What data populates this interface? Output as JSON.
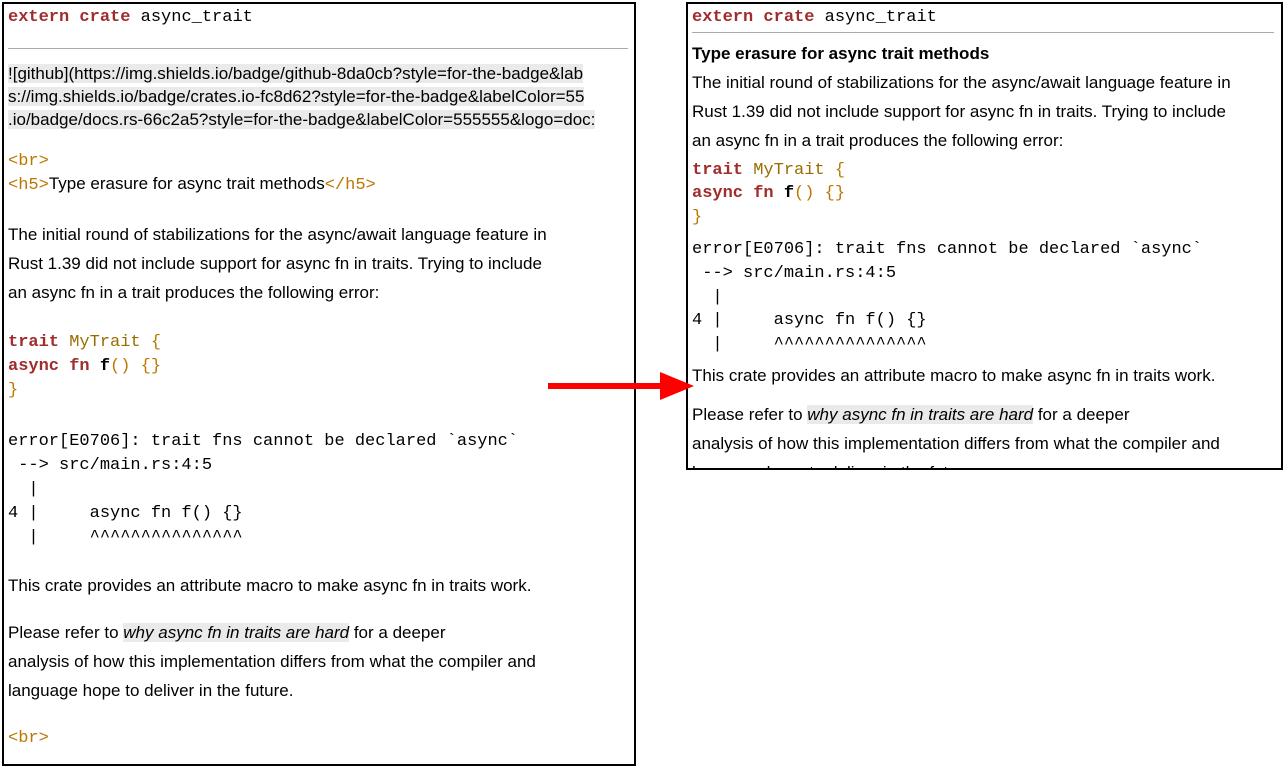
{
  "crate_decl": {
    "kw_extern": "extern",
    "kw_crate": "crate",
    "name": "async_trait"
  },
  "left": {
    "badge_line1": "![github](https://img.shields.io/badge/github-8da0cb?style=for-the-badge&lab",
    "badge_line2": "s://img.shields.io/badge/crates.io-fc8d62?style=for-the-badge&labelColor=55",
    "badge_line3": ".io/badge/docs.rs-66c2a5?style=for-the-badge&labelColor=555555&logo=doc:",
    "br_tag": "<br>",
    "h5_open": "<h5>",
    "h5_text": "Type erasure for async trait methods",
    "h5_close": "</h5>",
    "br_tag2": "<br>"
  },
  "headline": "Type erasure for async trait methods",
  "intro_p1": "The initial round of stabilizations for the async/await language feature in",
  "intro_p2": "Rust 1.39 did not include support for async fn in traits. Trying to include",
  "intro_p3": "an async fn in a trait produces the following error:",
  "code": {
    "trait_kw": "trait",
    "trait_name": "MyTrait",
    "brace_open": "{",
    "indent": "    ",
    "async_kw": "async",
    "fn_kw": "fn",
    "fn_name": "f",
    "parens": "()",
    "braces": "{}",
    "brace_close": "}"
  },
  "error_block": "error[E0706]: trait fns cannot be declared `async`\n --> src/main.rs:4:5\n  |\n4 |     async fn f() {}\n  |     ^^^^^^^^^^^^^^^",
  "after1": "This crate provides an attribute macro to make async fn in traits work.",
  "after2a": "Please refer to ",
  "link_text": "why async fn in traits are hard",
  "after2b": " for a deeper",
  "after3": "analysis of how this implementation differs from what the compiler and",
  "after4": "language hope to deliver in the future."
}
